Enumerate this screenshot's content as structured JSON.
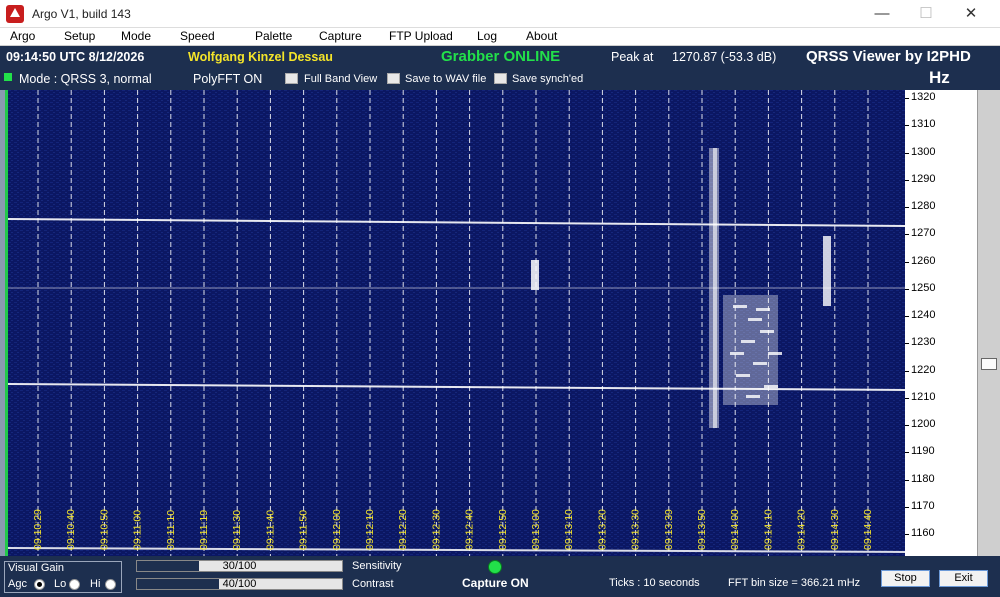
{
  "window": {
    "title": "Argo V1, build 143",
    "minimize_icon": "minimize-icon",
    "maximize_icon": "maximize-icon",
    "close_icon": "close-icon"
  },
  "menu": [
    "Argo",
    "Setup",
    "Mode",
    "Speed",
    "Palette",
    "Capture",
    "FTP Upload",
    "Log",
    "About"
  ],
  "info": {
    "time": "09:14:50 UTC  8/12/2026",
    "callsign": "Wolfgang Kinzel Dessau",
    "grabber": "Grabber ONLINE",
    "peak_label": "Peak at",
    "peak_value": "1270.87 (-53.3 dB)",
    "viewer": "QRSS Viewer by I2PHD",
    "hz": "Hz"
  },
  "mode": {
    "mode_text": "Mode : QRSS 3, normal",
    "polyfft": "PolyFFT ON",
    "full_band_view": "Full Band View",
    "save_wav": "Save to WAV file",
    "save_synched": "Save synch'ed"
  },
  "spectrum": {
    "time_labels": [
      "09:10:29",
      "09:10:40",
      "09:10:50",
      "09:11:00",
      "09:11:10",
      "09:11:19",
      "09:11:30",
      "09:11:40",
      "09:11:50",
      "09:12:00",
      "09:12:10",
      "09:12:20",
      "09:12:30",
      "09:12:40",
      "09:12:50",
      "09:13:00",
      "09:13:10",
      "09:13:20",
      "09:13:30",
      "09:13:39",
      "09:13:50",
      "09:14:00",
      "09:14:10",
      "09:14:20",
      "09:14:30",
      "09:14:40"
    ],
    "freq_labels": [
      "1320",
      "1310",
      "1300",
      "1290",
      "1280",
      "1270",
      "1260",
      "1250",
      "1240",
      "1230",
      "1220",
      "1210",
      "1200",
      "1190",
      "1180",
      "1170",
      "1160"
    ],
    "background_color": "#0b1763",
    "grid_color": "#ffffff",
    "time_label_color": "#f5e52a"
  },
  "controls": {
    "visual_gain": "Visual Gain",
    "agc": "Agc",
    "lo": "Lo",
    "hi": "Hi",
    "sensitivity_value": "30/100",
    "sensitivity_fraction": 0.3,
    "sensitivity_label": "Sensitivity",
    "contrast_value": "40/100",
    "contrast_fraction": 0.4,
    "contrast_label": "Contrast",
    "capture_label": "Capture ON",
    "ticks": "Ticks  :  10 seconds",
    "fft_bin": "FFT bin size = 366.21 mHz",
    "stop": "Stop",
    "exit": "Exit"
  }
}
